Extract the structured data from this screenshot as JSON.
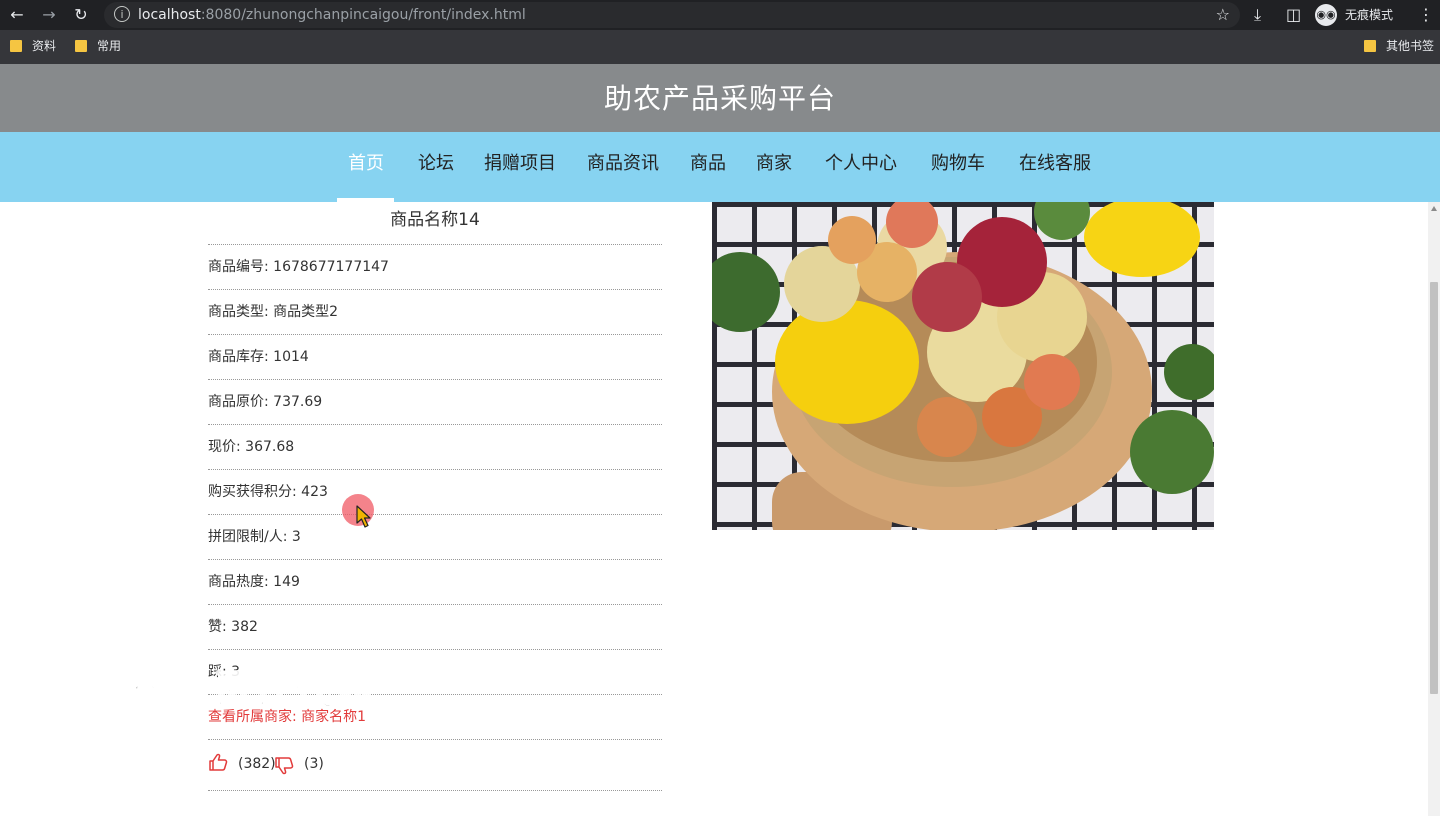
{
  "browser": {
    "url_host": "localhost",
    "url_rest": ":8080/zhunongchanpincaigou/front/index.html",
    "incognito_label": "无痕模式",
    "bookmarks": [
      "资料",
      "常用"
    ],
    "other_bookmarks": "其他书签"
  },
  "site": {
    "title": "助农产品采购平台",
    "nav": [
      "首页",
      "论坛",
      "捐赠项目",
      "商品资讯",
      "商品",
      "商家",
      "个人中心",
      "购物车",
      "在线客服"
    ],
    "active_nav": "首页"
  },
  "product": {
    "name": "商品名称14",
    "fields": [
      "商品编号: 1678677177147",
      "商品类型: 商品类型2",
      "商品库存: 1014",
      "商品原价: 737.69",
      "现价: 367.68",
      "购买获得积分: 423",
      "拼团限制/人: 3",
      "商品热度: 149",
      "赞: 382",
      "踩: 3"
    ],
    "merchant_link": "查看所属商家: 商家名称1",
    "like_count": "(382)",
    "dislike_count": "(3)",
    "image_icon": "fruit-basket-image"
  },
  "overlay": {
    "watermark": "专业毕业设计代做"
  },
  "colors": {
    "header_bg": "#878a8c",
    "nav_bg": "#87d3f1",
    "accent_red": "#e23b3b"
  }
}
